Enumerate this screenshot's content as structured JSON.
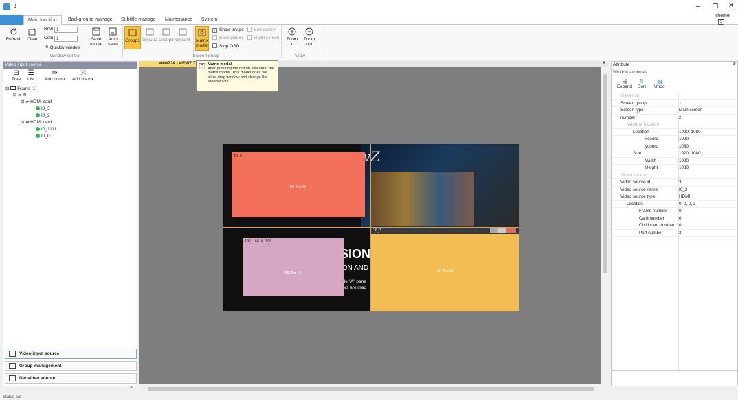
{
  "window": {
    "theme_label": "Theme",
    "theme_value": "5"
  },
  "ribbon_tabs": [
    "Main function",
    "Background manage",
    "Subtitle manage",
    "Maintenance",
    "System"
  ],
  "ribbon": {
    "refresh": "Refresh",
    "clear": "Clear",
    "row_label": "Row",
    "row_value": "1",
    "colu_label": "Colu",
    "colu_value": "1",
    "quickly_window": "Quickly window",
    "save_modal_1": "Save",
    "save_modal_2": "modal",
    "auto_save_1": "Auto",
    "auto_save_2": "save",
    "window_control": "Window control",
    "groups": [
      "Group1",
      "Group2",
      "Group3",
      "Group4"
    ],
    "matrix_model_1": "Matrix",
    "matrix_model_2": "model",
    "show_image": "Show image",
    "back_picture": "Back picture",
    "stop_osd": "Stop OSD",
    "left_screen": "Left screen",
    "right_screen": "Right screen",
    "screen_group": "Screen group",
    "zoom_in_1": "Zoom",
    "zoom_in_2": "in",
    "zoom_out_1": "Zoom",
    "zoom_out_2": "out",
    "view": "View"
  },
  "left_panel": {
    "title": "Video input source",
    "tools": [
      "Tree",
      "List",
      "Add comb",
      "Add matrix"
    ],
    "tree": [
      {
        "label": "Frame [1]"
      },
      {
        "label": "I0"
      },
      {
        "label": "HDMI card"
      },
      {
        "label": "I0_3"
      },
      {
        "label": "I0_2"
      },
      {
        "label": "HDMI card"
      },
      {
        "label": "I0_1111"
      },
      {
        "label": "I0_0"
      }
    ],
    "nav": [
      "Video input source",
      "Group management",
      "Net video source"
    ]
  },
  "center": {
    "doc_tab": "ViewZ34 - VIEWZ TES",
    "tooltip_title": "Matrix modal",
    "tooltip_body": "After pressing the button, will enter the matrix model. This model does not allow drag window and change the window size.",
    "windows": [
      {
        "title": "I0_0",
        "port": "00:Port0",
        "color": "#f3705a"
      },
      {
        "title": "192.168.0.198",
        "port": "00:Port2",
        "color": "#d6a7c2"
      },
      {
        "title": "I0_3",
        "port": "00:Port3",
        "color": "#f2be54"
      }
    ],
    "bg_text_logo": "ewZ",
    "bg_text_1": "SIONA",
    "bg_text_2": "ION AND 3",
    "bg_text_3": "ade \"A\" pane",
    "bg_text_4": "itors are mad"
  },
  "right_panel": {
    "title": "Attribute",
    "subtitle": "Window attributes",
    "tools": [
      "Expand",
      "Sort",
      "Undo"
    ],
    "rows": [
      {
        "k": "Base info",
        "v": "",
        "sec": true,
        "indent": 0
      },
      {
        "k": "Screen group",
        "v": "1",
        "sec": false,
        "indent": 0
      },
      {
        "k": "Screen type",
        "v": "Main screen",
        "sec": false,
        "indent": 0
      },
      {
        "k": "number",
        "v": "2",
        "sec": false,
        "indent": 0
      },
      {
        "k": "Window location",
        "v": "",
        "sec": true,
        "indent": 1
      },
      {
        "k": "Location",
        "v": "1920, 1080",
        "sec": false,
        "indent": 2
      },
      {
        "k": "xcoord",
        "v": "1920",
        "sec": false,
        "indent": 4
      },
      {
        "k": "ycoord",
        "v": "1080",
        "sec": false,
        "indent": 4
      },
      {
        "k": "Size",
        "v": "1920, 1080",
        "sec": false,
        "indent": 2
      },
      {
        "k": "Width",
        "v": "1920",
        "sec": false,
        "indent": 4
      },
      {
        "k": "Height",
        "v": "1080",
        "sec": false,
        "indent": 4
      },
      {
        "k": "Video source",
        "v": "",
        "sec": true,
        "indent": 0
      },
      {
        "k": "Video source id",
        "v": "3",
        "sec": false,
        "indent": 0
      },
      {
        "k": "Video source name",
        "v": "I0_3",
        "sec": false,
        "indent": 0
      },
      {
        "k": "Video source type",
        "v": "HDMI",
        "sec": false,
        "indent": 0
      },
      {
        "k": "Location",
        "v": "0, 0, 0, 3",
        "sec": false,
        "indent": 1
      },
      {
        "k": "Frame number",
        "v": "0",
        "sec": false,
        "indent": 3
      },
      {
        "k": "Card number",
        "v": "0",
        "sec": false,
        "indent": 3
      },
      {
        "k": "Child card number",
        "v": "0",
        "sec": false,
        "indent": 3
      },
      {
        "k": "Port number",
        "v": "3",
        "sec": false,
        "indent": 3
      }
    ]
  },
  "status": "Status bar"
}
